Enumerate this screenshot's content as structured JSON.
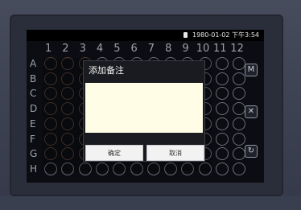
{
  "status": {
    "date": "1980-01-02",
    "time": "下午3:54"
  },
  "plate": {
    "columns": [
      "1",
      "2",
      "3",
      "4",
      "5",
      "6",
      "7",
      "8",
      "9",
      "10",
      "11",
      "12"
    ],
    "rows": [
      "A",
      "B",
      "C",
      "D",
      "E",
      "F",
      "G",
      "H"
    ]
  },
  "side_buttons": {
    "mark_label": "M",
    "clear_label": "✕",
    "reset_label": "↻"
  },
  "dialog": {
    "title": "添加备注",
    "note_value": "",
    "confirm_label": "确定",
    "cancel_label": "取消"
  }
}
